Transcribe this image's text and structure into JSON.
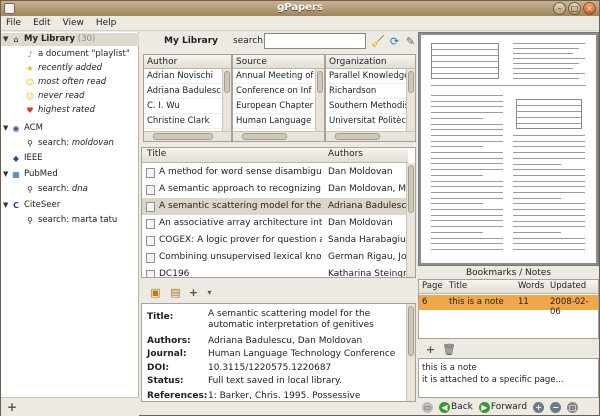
{
  "window": {
    "title": "gPapers"
  },
  "menu": [
    "File",
    "Edit",
    "View",
    "Help"
  ],
  "sidebar": {
    "library": {
      "label": "My Library",
      "count": "(30)"
    },
    "items": [
      {
        "label": "a document \"playlist\"",
        "italic": false
      },
      {
        "label": "recently added",
        "italic": true
      },
      {
        "label": "most often read",
        "italic": true
      },
      {
        "label": "never read",
        "italic": true
      },
      {
        "label": "highest rated",
        "italic": true
      }
    ],
    "sources": [
      {
        "label": "ACM",
        "search": "search: ",
        "term": "moldovan"
      },
      {
        "label": "IEEE"
      },
      {
        "label": "PubMed",
        "search": "search: ",
        "term": "dna"
      },
      {
        "label": "CiteSeer",
        "search": "search: marta tatu"
      }
    ]
  },
  "library_header": {
    "title": "My Library",
    "search_label": "search:",
    "search_value": ""
  },
  "filters": {
    "author": {
      "header": "Author",
      "rows": [
        "Adrian Novischi",
        "Adriana Badulesc",
        "C. I. Wu",
        "Christine Clark"
      ]
    },
    "source": {
      "header": "Source",
      "rows": [
        "Annual Meeting of",
        "Conference on Inf",
        "European Chapter",
        "Human Language"
      ]
    },
    "organization": {
      "header": "Organization",
      "rows": [
        "Parallel Knowledge",
        "Richardson",
        "Southern Methodis",
        "Universitat Politèc"
      ]
    }
  },
  "papers": {
    "col_title": "Title",
    "col_authors": "Authors",
    "rows": [
      {
        "title": "A method for word sense disambiguat…",
        "authors": "Dan Moldovan"
      },
      {
        "title": "A semantic approach to recognizing te…",
        "authors": "Dan Moldovan, Mar"
      },
      {
        "title": "A semantic scattering model for the a…",
        "authors": "Adriana Badulescu"
      },
      {
        "title": "An associative array architecture inte…",
        "authors": "Dan Moldovan"
      },
      {
        "title": "COGEX: A logic prover for question an…",
        "authors": "Sanda Harabagiu,"
      },
      {
        "title": "Combining unsupervised lexical knowl…",
        "authors": "German Rigau, Jor"
      },
      {
        "title": "DC196",
        "authors": "Katharina Steingra"
      }
    ]
  },
  "details": {
    "title_label": "Title:",
    "title_value": "A semantic scattering model for the automatic interpretation of genitives",
    "authors_label": "Authors:",
    "authors_value": "Adriana Badulescu, Dan Moldovan",
    "journal_label": "Journal:",
    "journal_value": "Human Language Technology Conference",
    "doi_label": "DOI:",
    "doi_value": "10.3115/1220575.1220687",
    "status_label": "Status:",
    "status_value": "Full text saved in local library.",
    "refs_label": "References:",
    "refs_value": "1: Barker, Chris. 1995. Possessive"
  },
  "bookmarks": {
    "title": "Bookmarks / Notes",
    "headers": {
      "page": "Page",
      "title": "Title",
      "words": "Words",
      "updated": "Updated"
    },
    "row": {
      "page": "6",
      "title": "this is a note",
      "words": "11",
      "updated": "2008-02-06"
    },
    "note_line1": "this is a note",
    "note_line2": "it is attached to a specific page..."
  },
  "nav": {
    "back": "Back",
    "forward": "Forward"
  },
  "colors": {
    "accent": "#f0a74a",
    "titlebar": "#9d8461",
    "selection": "#dcd5c8"
  }
}
